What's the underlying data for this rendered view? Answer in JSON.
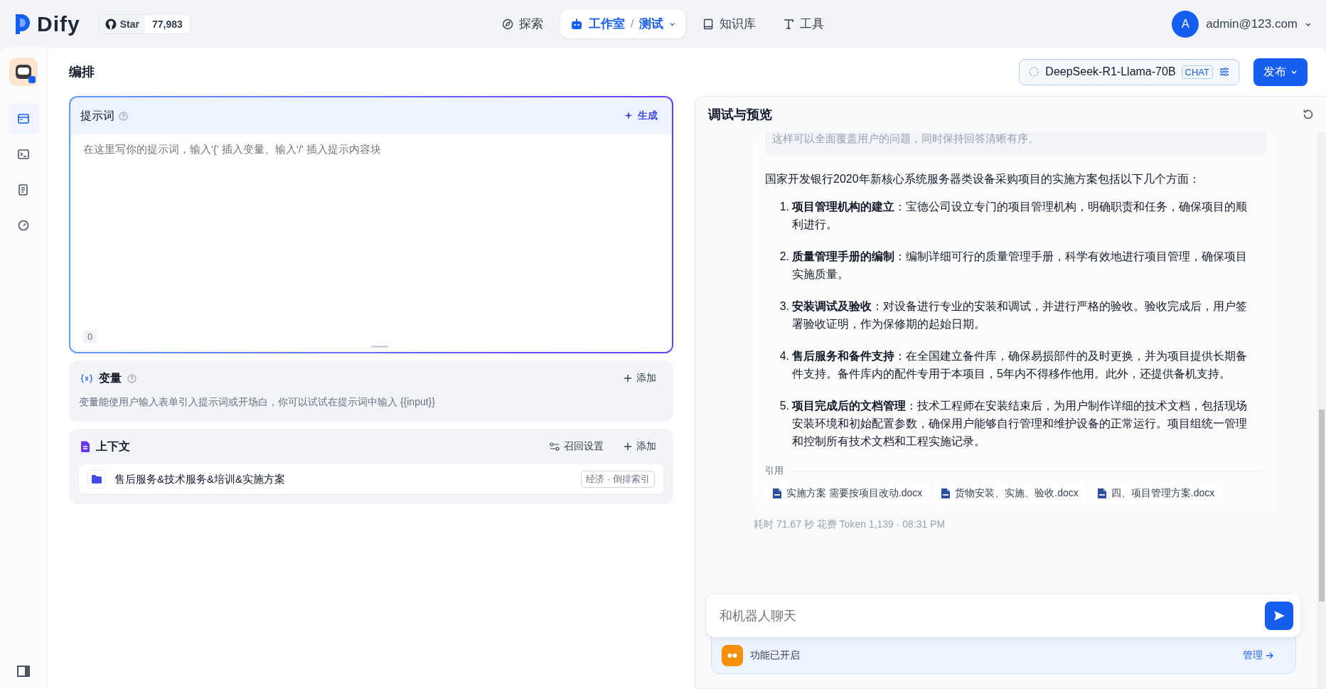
{
  "brand": {
    "name": "Dify",
    "star_label": "Star",
    "star_count": "77,983"
  },
  "nav": [
    {
      "label": "探索",
      "selected": false
    },
    {
      "label": "工作室",
      "separator": "/",
      "sub": "测试",
      "selected": true
    },
    {
      "label": "知识库",
      "selected": false
    },
    {
      "label": "工具",
      "selected": false
    }
  ],
  "user": {
    "avatar": "A",
    "email": "admin@123.com"
  },
  "app_sidebar": {
    "items": [
      {
        "selected": true
      },
      {
        "selected": false
      },
      {
        "selected": false
      },
      {
        "selected": false
      }
    ]
  },
  "header": {
    "title": "编排",
    "model": "DeepSeek-R1-Llama-70B",
    "model_mode": "CHAT",
    "publish": "发布"
  },
  "prompt": {
    "title": "提示词",
    "generate": "生成",
    "placeholder": "在这里写你的提示词，输入'{' 插入变量、输入'/' 插入提示内容块",
    "count": "0"
  },
  "variables": {
    "title": "变量",
    "add": "添加",
    "description": "变量能使用户输入表单引入提示词或开场白，你可以试试在提示词中输入 {{input}}"
  },
  "context": {
    "title": "上下文",
    "settings": "召回设置",
    "add": "添加",
    "datasets": [
      {
        "name": "售后服务&技术服务&培训&实施方案",
        "tag": "经济 · 倒排索引"
      }
    ]
  },
  "preview": {
    "title": "调试与预览",
    "quote_tail": "这样可以全面覆盖用户的问题，同时保持回答清晰有序。",
    "intro": "国家开发银行2020年新核心系统服务器类设备采购项目的实施方案包括以下几个方面：",
    "items": [
      {
        "number": "1.",
        "text": "**项目管理机构的建立**：宝德公司设立专门的项目管理机构，明确职责和任务，确保项目的顺利进行。"
      },
      {
        "number": "2.",
        "text": "**质量管理手册的编制**：编制详细可行的质量管理手册，科学有效地进行项目管理，确保项目实施质量。"
      },
      {
        "number": "3.",
        "text": "**安装调试及验收**：对设备进行专业的安装和调试，并进行严格的验收。验收完成后，用户签署验收证明，作为保修期的起始日期。"
      },
      {
        "number": "4.",
        "text": "**售后服务和备件支持**：在全国建立备件库，确保易损部件的及时更换，并为项目提供长期备件支持。备件库内的配件专用于本项目，5年内不得移作他用。此外，还提供备机支持。"
      },
      {
        "number": "5.",
        "text": "**项目完成后的文档管理**：技术工程师在安装结束后，为用户制作详细的技术文档，包括现场安装环境和初始配置参数，确保用户能够自行管理和维护设备的正常运行。项目组统一管理和控制所有技术文档和工程实施记录。"
      }
    ],
    "citation_label": "引用",
    "citations": [
      "实施方案 需要按项目改动.docx",
      "货物安装、实施、验收.docx",
      "四、项目管理方案.docx"
    ],
    "meta": "耗时 71.67 秒  花费 Token 1,139 · 08:31 PM"
  },
  "chat": {
    "placeholder": "和机器人聊天",
    "features": "功能已开启",
    "manage": "管理"
  }
}
